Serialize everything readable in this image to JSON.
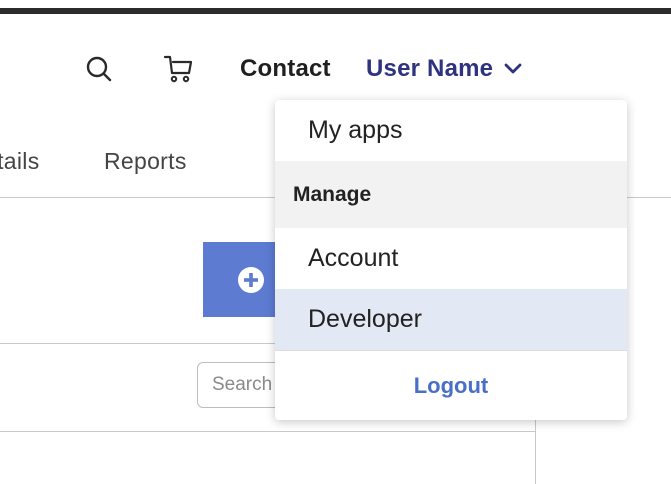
{
  "header": {
    "search_icon": "search-icon",
    "cart_icon": "cart-icon",
    "contact_label": "Contact",
    "user_name": "User Name",
    "chevron_icon": "chevron-down-icon",
    "user_color": "#2e3380"
  },
  "nav": {
    "tabs": [
      {
        "label": "etails"
      },
      {
        "label": "Reports"
      }
    ]
  },
  "add_button": {
    "icon": "plus-circle-icon",
    "color": "#5d7bd1"
  },
  "panel": {
    "search_placeholder": "Search"
  },
  "dropdown": {
    "items": [
      {
        "label": "My apps"
      },
      {
        "label": "Manage"
      },
      {
        "label": "Account"
      },
      {
        "label": "Developer"
      }
    ],
    "logout_label": "Logout",
    "highlight_color": "#e3e8f5",
    "logout_color": "#4a6fc7"
  }
}
